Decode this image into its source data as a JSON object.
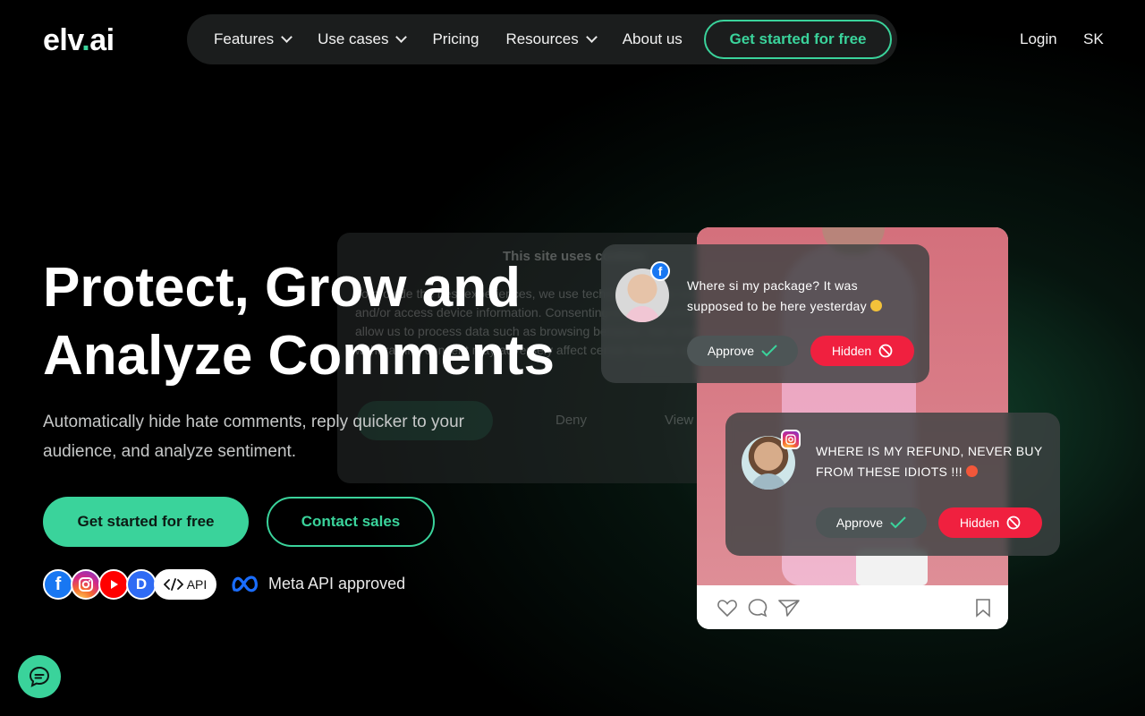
{
  "header": {
    "logo_left": "elv",
    "logo_dot": ".",
    "logo_right": "ai",
    "nav": [
      {
        "label": "Features",
        "dropdown": true
      },
      {
        "label": "Use cases",
        "dropdown": true
      },
      {
        "label": "Pricing",
        "dropdown": false
      },
      {
        "label": "Resources",
        "dropdown": true
      },
      {
        "label": "About us",
        "dropdown": false
      }
    ],
    "cta": "Get started for free",
    "login": "Login",
    "language": "SK"
  },
  "hero": {
    "title_line1": "Protect, Grow and",
    "title_line2": "Analyze Comments",
    "subtitle": "Automatically hide hate comments, reply quicker to your audience, and analyze sentiment.",
    "primary_button": "Get started for free",
    "secondary_button": "Contact sales",
    "platforms": {
      "facebook": "f",
      "discord": "D",
      "api": "API"
    },
    "meta_label": "Meta API approved"
  },
  "cookie_banner": {
    "title": "This site uses cookies",
    "text": "To provide the best experiences, we use technologies like cookies to store and/or access device information. Consenting to these technologies will allow us to process data such as browsing behavior. Not consenting or withdrawing consent may adversely affect certain features and functions.",
    "deny": "Deny",
    "preferences": "View preferences"
  },
  "comments": [
    {
      "platform": "facebook",
      "text": "Where si my package? It was supposed to be here yesterday",
      "approve_label": "Approve",
      "hidden_label": "Hidden"
    },
    {
      "platform": "instagram",
      "text": "WHERE IS MY REFUND, NEVER BUY FROM THESE IDIOTS !!!",
      "approve_label": "Approve",
      "hidden_label": "Hidden"
    }
  ],
  "colors": {
    "accent": "#3ad39b",
    "danger": "#f0203f",
    "background": "#000000"
  }
}
